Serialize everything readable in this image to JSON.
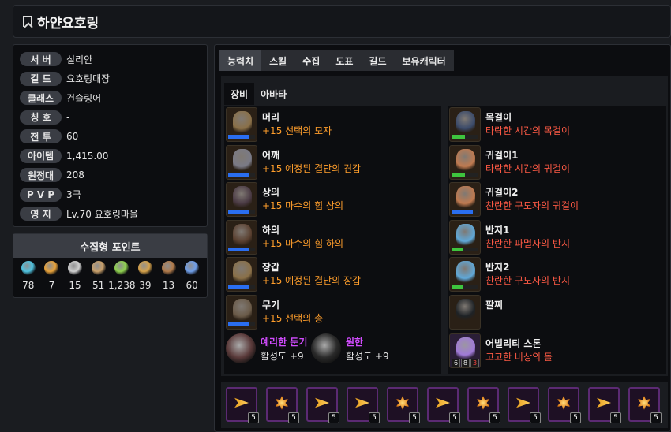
{
  "header": {
    "title": "하얀요호링"
  },
  "info": [
    {
      "label": "서 버",
      "value": "실리안"
    },
    {
      "label": "길 드",
      "value": "요호링대장"
    },
    {
      "label": "클래스",
      "value": "건슬링어"
    },
    {
      "label": "칭 호",
      "value": "-"
    },
    {
      "label": "전 투",
      "value": "60"
    },
    {
      "label": "아이템",
      "value": "1,415.00"
    },
    {
      "label": "원정대",
      "value": "208"
    },
    {
      "label": "P V P",
      "value": "3극"
    },
    {
      "label": "영 지",
      "value": "Lv.70 요호링마을"
    }
  ],
  "collect": {
    "title": "수집형 포인트",
    "items": [
      {
        "icon": "island-heart-icon",
        "value": "78",
        "color": "#4fc3e0"
      },
      {
        "icon": "star-icon",
        "value": "7",
        "color": "#e8a23a"
      },
      {
        "icon": "giant-heart-icon",
        "value": "15",
        "color": "#cfcfcf"
      },
      {
        "icon": "art-scroll-icon",
        "value": "51",
        "color": "#c9a06a"
      },
      {
        "icon": "mokoko-seed-icon",
        "value": "1,238",
        "color": "#8fd14f"
      },
      {
        "icon": "voyage-telescope-icon",
        "value": "39",
        "color": "#d6a24a"
      },
      {
        "icon": "ignea-token-icon",
        "value": "13",
        "color": "#b07a4a"
      },
      {
        "icon": "world-tree-leaf-icon",
        "value": "60",
        "color": "#6f9ee8"
      }
    ]
  },
  "tabs": [
    "능력치",
    "스킬",
    "수집",
    "도표",
    "길드",
    "보유캐릭터"
  ],
  "subtabs": [
    "장비",
    "아바타"
  ],
  "equipment_left": [
    {
      "slot": "머리",
      "name": "+15 선택의 모자",
      "quality": 0.8,
      "bar": "#2a6ef0",
      "tint": "#8a7048"
    },
    {
      "slot": "어깨",
      "name": "+15 예정된 결단의 견갑",
      "quality": 0.8,
      "bar": "#2a6ef0",
      "tint": "#7a7a86"
    },
    {
      "slot": "상의",
      "name": "+15 마수의 힘 상의",
      "quality": 0.8,
      "bar": "#2a6ef0",
      "tint": "#4a3a44"
    },
    {
      "slot": "하의",
      "name": "+15 마수의 힘 하의",
      "quality": 0.8,
      "bar": "#2a6ef0",
      "tint": "#5a4030"
    },
    {
      "slot": "장갑",
      "name": "+15 예정된 결단의 장갑",
      "quality": 0.8,
      "bar": "#2a6ef0",
      "tint": "#8a7048"
    },
    {
      "slot": "무기",
      "name": "+15 선택의 총",
      "quality": 0.8,
      "bar": "#2a6ef0",
      "tint": "#6a5a48"
    }
  ],
  "gems": [
    {
      "name": "예리한 둔기",
      "value": "활성도 +9",
      "color": "#5a3a3a"
    },
    {
      "name": "원한",
      "value": "활성도 +9",
      "color": "#2a2a2a"
    }
  ],
  "equipment_right": [
    {
      "slot": "목걸이",
      "name": "타락한 시간의 목걸이",
      "quality": 0.5,
      "bar": "#3ec43e",
      "tint": "#3a4a6a"
    },
    {
      "slot": "귀걸이1",
      "name": "타락한 시간의 귀걸이",
      "quality": 0.5,
      "bar": "#3ec43e",
      "tint": "#c07a50"
    },
    {
      "slot": "귀걸이2",
      "name": "찬란한 구도자의 귀걸이",
      "quality": 0.8,
      "bar": "#2a6ef0",
      "tint": "#c07a50"
    },
    {
      "slot": "반지1",
      "name": "찬란한 파멸자의 반지",
      "quality": 0.4,
      "bar": "#3ec43e",
      "tint": "#60a8d8"
    },
    {
      "slot": "반지2",
      "name": "찬란한 구도자의 반지",
      "quality": 0.4,
      "bar": "#3ec43e",
      "tint": "#60a8d8"
    },
    {
      "slot": "팔찌",
      "name": "",
      "quality": 0,
      "bar": "#333",
      "tint": "#1e2226"
    }
  ],
  "stone": {
    "slot": "어빌리티 스톤",
    "name": "고고한 비상의 돌",
    "badges": [
      "6",
      "8",
      "3"
    ]
  },
  "cards": [
    {
      "icon": "arrow-gem-icon",
      "level": "5"
    },
    {
      "icon": "burst-gem-icon",
      "level": "5"
    },
    {
      "icon": "arrow-gem-icon",
      "level": "5"
    },
    {
      "icon": "arrow-gem-icon",
      "level": "5"
    },
    {
      "icon": "burst-gem-icon",
      "level": "5"
    },
    {
      "icon": "arrow-gem-icon",
      "level": "5"
    },
    {
      "icon": "burst-gem-icon",
      "level": "5"
    },
    {
      "icon": "arrow-gem-icon",
      "level": "5"
    },
    {
      "icon": "burst-gem-icon",
      "level": "5"
    },
    {
      "icon": "arrow-gem-icon",
      "level": "5"
    },
    {
      "icon": "burst-gem-icon",
      "level": "5"
    }
  ]
}
